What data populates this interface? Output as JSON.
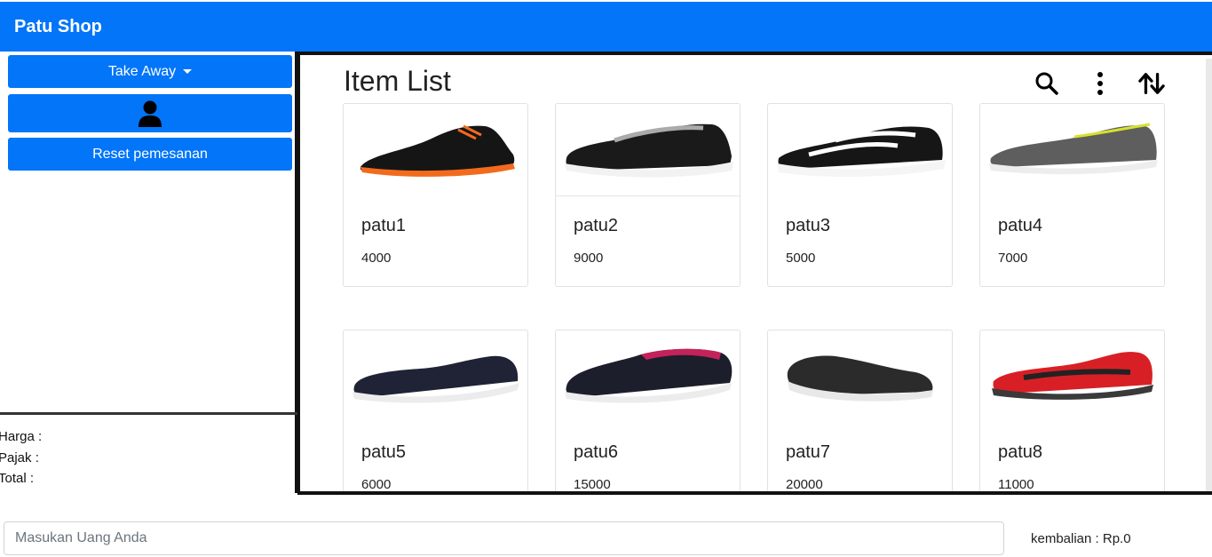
{
  "navbar": {
    "brand": "Patu Shop"
  },
  "left": {
    "takeaway_label": "Take Away",
    "reset_label": "Reset pemesanan",
    "totals": {
      "harga": "Harga :",
      "pajak": "Pajak :",
      "total": "Total :"
    }
  },
  "main": {
    "title": "Item List",
    "items": [
      {
        "name": "patu1",
        "price": "4000"
      },
      {
        "name": "patu2",
        "price": "9000"
      },
      {
        "name": "patu3",
        "price": "5000"
      },
      {
        "name": "patu4",
        "price": "7000"
      },
      {
        "name": "patu5",
        "price": "6000"
      },
      {
        "name": "patu6",
        "price": "15000"
      },
      {
        "name": "patu7",
        "price": "20000"
      },
      {
        "name": "patu8",
        "price": "11000"
      }
    ]
  },
  "footer": {
    "input_placeholder": "Masukan Uang Anda",
    "kembalian": "kembalian : Rp.0"
  },
  "colors": {
    "primary": "#0275f8",
    "border": "#111111"
  },
  "icons": [
    "user-icon",
    "search-icon",
    "more-vertical-icon",
    "sort-icon",
    "shoe-image"
  ]
}
